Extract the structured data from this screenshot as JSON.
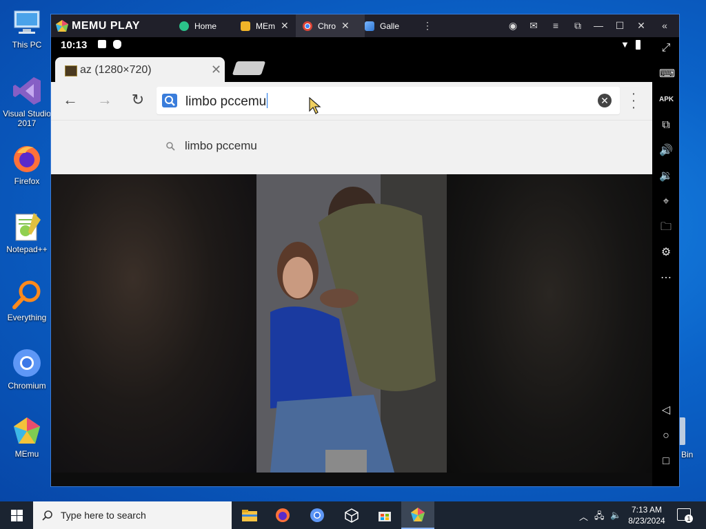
{
  "desktop": {
    "icons": [
      {
        "label": "This PC"
      },
      {
        "label": "Visual Studio 2017"
      },
      {
        "label": "Firefox"
      },
      {
        "label": "Notepad++"
      },
      {
        "label": "Everything"
      },
      {
        "label": "Chromium"
      },
      {
        "label": "MEmu"
      }
    ],
    "recycle_bin_label": "Bin"
  },
  "memu": {
    "brand": "MEMU PLAY",
    "tabs": [
      {
        "label": "Home",
        "icon": "memu-home-icon",
        "closable": false
      },
      {
        "label": "MEm",
        "icon": "memu-market-icon",
        "closable": true
      },
      {
        "label": "Chro",
        "icon": "chrome-icon",
        "closable": true,
        "active": true
      },
      {
        "label": "Galle",
        "icon": "gallery-icon",
        "closable": false
      }
    ]
  },
  "android": {
    "time": "10:13",
    "chrome": {
      "tab_title": "az (1280×720)",
      "omnibox_text": "limbo pccemu",
      "suggestion": "limbo pccemu"
    }
  },
  "taskbar": {
    "search_placeholder": "Type here to search",
    "time": "7:13 AM",
    "date": "8/23/2024",
    "notification_count": "1"
  },
  "colors": {
    "desktop_bg": "#0b63c9",
    "taskbar": "#1b2431",
    "memu_titlebar": "#20202a",
    "chrome_toolbar": "#f1f1f1"
  }
}
